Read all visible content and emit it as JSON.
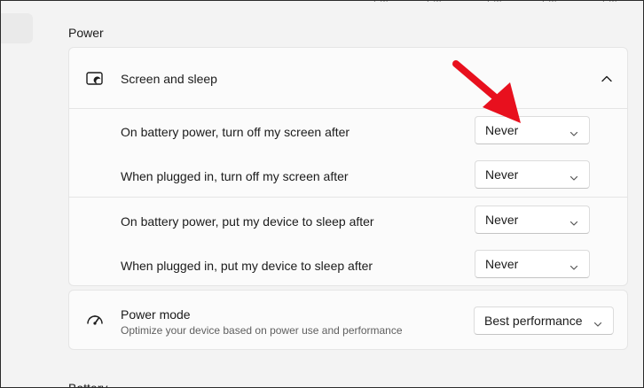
{
  "top_ticks": [
    "PM",
    "PM",
    "PM",
    "PM",
    "PM"
  ],
  "power_section": {
    "title": "Power"
  },
  "screen_and_sleep": {
    "title": "Screen and sleep",
    "icon": "screen-sleep-icon",
    "rows": [
      {
        "label": "On battery power, turn off my screen after",
        "value": "Never"
      },
      {
        "label": "When plugged in, turn off my screen after",
        "value": "Never"
      },
      {
        "label": "On battery power, put my device to sleep after",
        "value": "Never"
      },
      {
        "label": "When plugged in, put my device to sleep after",
        "value": "Never"
      }
    ]
  },
  "power_mode": {
    "title": "Power mode",
    "subtitle": "Optimize your device based on power use and performance",
    "icon": "gauge-icon",
    "value": "Best performance"
  },
  "battery_section": {
    "title": "Battery"
  },
  "colors": {
    "annotation_arrow": "#e8101e",
    "background": "#f3f3f3",
    "card": "#fbfbfb"
  }
}
